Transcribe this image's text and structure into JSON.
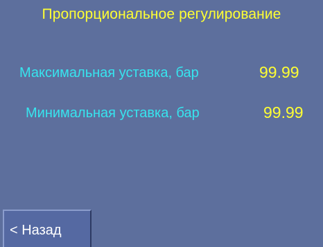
{
  "screen": {
    "title": "Пропорциональное регулирование"
  },
  "settings": {
    "max_setpoint": {
      "label": "Максимальная уставка, бар",
      "value": "99.99"
    },
    "min_setpoint": {
      "label": "Минимальная уставка, бар",
      "value": "99.99"
    }
  },
  "navigation": {
    "back_label": "< Назад"
  },
  "colors": {
    "background": "#5d6f9d",
    "title_text": "#ffff33",
    "label_text": "#37e4ee",
    "value_text": "#ffff33",
    "button_text": "#ffffff"
  }
}
